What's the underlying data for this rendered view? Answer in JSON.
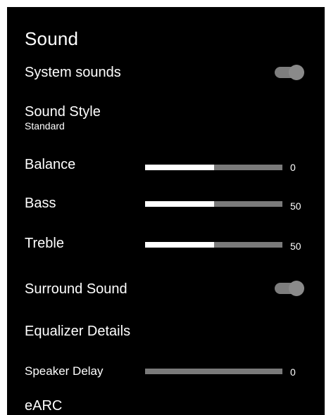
{
  "panel": {
    "title": "Sound"
  },
  "items": {
    "system_sounds": {
      "label": "System sounds",
      "toggle_on": true
    },
    "sound_style": {
      "label": "Sound Style",
      "value": "Standard"
    },
    "balance": {
      "label": "Balance",
      "value_text": "0",
      "fill_fraction": 0.5
    },
    "bass": {
      "label": "Bass",
      "value_text": "50",
      "fill_fraction": 0.5
    },
    "treble": {
      "label": "Treble",
      "value_text": "50",
      "fill_fraction": 0.5
    },
    "surround_sound": {
      "label": "Surround Sound",
      "toggle_on": true
    },
    "equalizer_details": {
      "label": "Equalizer Details"
    },
    "speaker_delay": {
      "label": "Speaker Delay",
      "value_text": "0",
      "fill_fraction": 0
    },
    "earc": {
      "label": "eARC"
    }
  },
  "colors": {
    "panel_background": "#000000",
    "text": "#ffffff",
    "slider_track": "#7a7a7a",
    "slider_fill": "#ffffff",
    "toggle": "#8a8a8a"
  }
}
